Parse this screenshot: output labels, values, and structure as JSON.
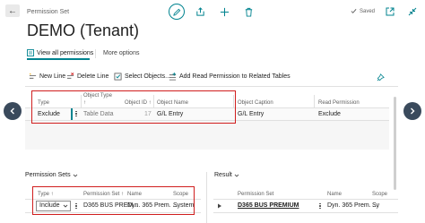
{
  "header": {
    "back": "←",
    "breadcrumb": "Permission Set",
    "saved_label": "Saved"
  },
  "page_title": "DEMO (Tenant)",
  "top_tabs": [
    {
      "label": "View all permissions"
    },
    {
      "label": "More options"
    }
  ],
  "toolbar": {
    "new_line": "New Line",
    "delete_line": "Delete Line",
    "select_objects": "Select Objects...",
    "add_read": "Add Read Permission to Related Tables"
  },
  "main_table": {
    "headers": {
      "type": "Type",
      "object_type": "Object Type",
      "object_type_sort": "↑",
      "object_id": "Object ID ↑",
      "object_name": "Object Name",
      "object_caption": "Object Caption",
      "read_permission": "Read Permission"
    },
    "row": {
      "type": "Exclude",
      "object_type": "Table Data",
      "object_id": "17",
      "object_name": "G/L Entry",
      "object_caption": "G/L Entry",
      "read_permission": "Exclude"
    }
  },
  "permission_sets": {
    "title": "Permission Sets",
    "headers": {
      "type": "Type ↑",
      "permission_set": "Permission Set ↑",
      "name": "Name",
      "scope": "Scope"
    },
    "row": {
      "type": "Include",
      "permission_set": "D365 BUS PREM...",
      "name": "Dyn. 365 Prem. ...",
      "scope": "System"
    }
  },
  "result": {
    "title": "Result",
    "headers": {
      "permission_set": "Permission Set",
      "name": "Name",
      "scope": "Scope"
    },
    "row": {
      "permission_set": "D365 BUS PREMIUM",
      "name": "Dyn. 365 Prem. ...",
      "scope": "Sy"
    }
  },
  "colors": {
    "accent": "#00838f",
    "highlight_box": "#d01e1e",
    "nav_circle": "#3a4a5c"
  }
}
